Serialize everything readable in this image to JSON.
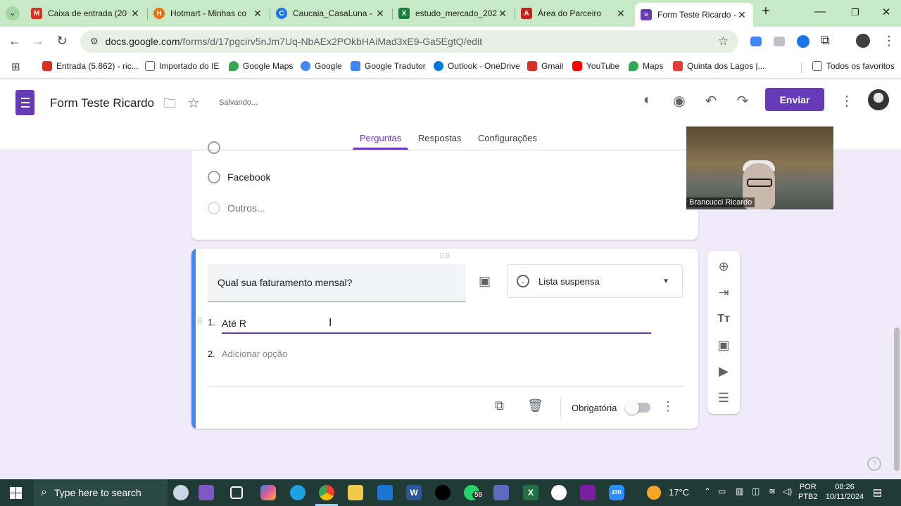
{
  "browser": {
    "tabs": [
      {
        "title": "Caixa de entrada (20",
        "color": "#d93025",
        "glyph": "M"
      },
      {
        "title": "Hotmart - Minhas co",
        "color": "#e8710a",
        "glyph": "H"
      },
      {
        "title": "Caucaia_CasaLuna -",
        "color": "#1a73e8",
        "glyph": "C"
      },
      {
        "title": "estudo_mercado_202",
        "color": "#188038",
        "glyph": "X"
      },
      {
        "title": "Área do Parceiro",
        "color": "#c5221f",
        "glyph": "A"
      },
      {
        "title": "Form Teste Ricardo -",
        "color": "#673ab7",
        "glyph": "≡"
      }
    ],
    "address": {
      "host": "docs.google.com",
      "path": "/forms/d/17pgcirv5nJm7Uq-NbAEx2POkbHAiMad3xE9-Ga5EgtQ/edit"
    },
    "bookmarks": [
      {
        "label": "Entrada (5.862) - ric...",
        "color": "#d93025"
      },
      {
        "label": "Importado do IE",
        "color": "#5f6368"
      },
      {
        "label": "Google Maps",
        "color": "#34a853"
      },
      {
        "label": "Google",
        "color": "#4285f4"
      },
      {
        "label": "Google Tradutor",
        "color": "#4285f4"
      },
      {
        "label": "Outlook - OneDrive",
        "color": "#0078d4"
      },
      {
        "label": "Gmail",
        "color": "#d93025"
      },
      {
        "label": "YouTube",
        "color": "#ff0000"
      },
      {
        "label": "Maps",
        "color": "#34a853"
      },
      {
        "label": "Quinta dos Lagos |...",
        "color": "#e53935"
      }
    ],
    "all_bookmarks_label": "Todos os favoritos"
  },
  "form": {
    "title": "Form Teste Ricardo",
    "status": "Salvando...",
    "send_label": "Enviar",
    "tabs": [
      "Perguntas",
      "Respostas",
      "Configurações"
    ],
    "accent": "#673ab7"
  },
  "prev_card": {
    "options": [
      "Facebook",
      "Outros..."
    ]
  },
  "question": {
    "title": "Qual sua faturamento mensal?",
    "type": "Lista suspensa",
    "options": [
      {
        "num": "1.",
        "text": "Até R"
      },
      {
        "num": "2.",
        "text": "Adicionar opção"
      }
    ],
    "required_label": "Obrigatória"
  },
  "video": {
    "name": "Brancucci Ricardo"
  },
  "taskbar": {
    "search_placeholder": "Type here to search",
    "whatsapp_badge": "58",
    "weather": "17°C",
    "lang": [
      "POR",
      "PTB2"
    ],
    "time": "08:26",
    "date": "10/11/2024"
  }
}
